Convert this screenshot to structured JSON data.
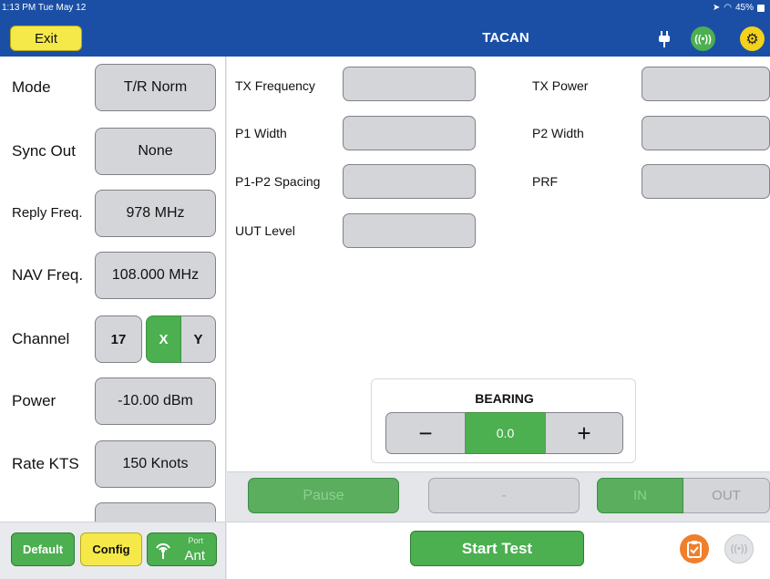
{
  "status_bar": {
    "time": "1:13 PM",
    "date": "Tue May 12",
    "location_glyph": "➤",
    "wifi_glyph": "◠",
    "battery": "45%"
  },
  "header": {
    "exit_label": "Exit",
    "title": "TACAN",
    "plug_icon": "plug-icon",
    "radio_icon_text": "((•))",
    "settings_icon_text": "⚙"
  },
  "left_panel": {
    "mode": {
      "label": "Mode",
      "value": "T/R Norm"
    },
    "sync_out": {
      "label": "Sync Out",
      "value": "None"
    },
    "reply_freq": {
      "label": "Reply Freq.",
      "value": "978 MHz"
    },
    "nav_freq": {
      "label": "NAV Freq.",
      "value": "108.000 MHz"
    },
    "channel": {
      "label": "Channel",
      "number": "17",
      "x": "X",
      "y": "Y",
      "selected": "X"
    },
    "power": {
      "label": "Power",
      "value": "-10.00 dBm"
    },
    "rate": {
      "label": "Rate KTS",
      "value": "150 Knots"
    }
  },
  "readouts": {
    "tx_frequency": "TX Frequency",
    "tx_power": "TX Power",
    "p1_width": "P1 Width",
    "p2_width": "P2 Width",
    "p1_p2_spacing": "P1-P2 Spacing",
    "prf": "PRF",
    "uut_level": "UUT Level"
  },
  "bearing": {
    "title": "BEARING",
    "minus": "−",
    "value": "0.0",
    "plus": "+"
  },
  "controls": {
    "pause": "Pause",
    "dash": "-",
    "in": "IN",
    "out": "OUT"
  },
  "bottom": {
    "default": "Default",
    "config": "Config",
    "port_small": "Port",
    "port_main": "Ant",
    "start": "Start Test",
    "antenna_icon_text": "((•))"
  }
}
